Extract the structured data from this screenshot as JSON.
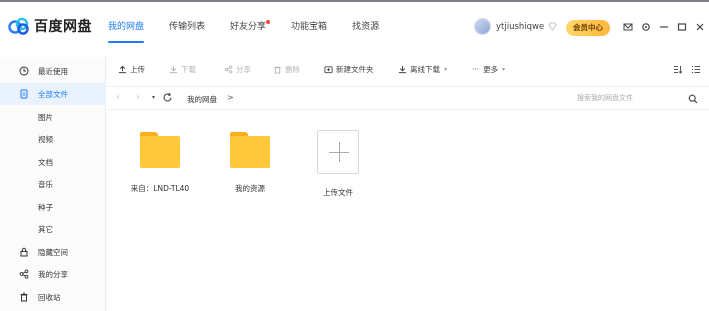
{
  "app": {
    "title": "百度网盘"
  },
  "nav": {
    "tabs": [
      {
        "label": "我的网盘",
        "active": true
      },
      {
        "label": "传输列表"
      },
      {
        "label": "好友分享",
        "dot": true
      },
      {
        "label": "功能宝箱"
      },
      {
        "label": "找资源"
      }
    ]
  },
  "user": {
    "name": "ytjiushiqwe",
    "vip_label": "会员中心"
  },
  "sidebar": {
    "items": [
      {
        "label": "最近使用",
        "icon": "clock-icon"
      },
      {
        "label": "全部文件",
        "icon": "file-icon",
        "active": true
      },
      {
        "label": "图片"
      },
      {
        "label": "视频"
      },
      {
        "label": "文档"
      },
      {
        "label": "音乐"
      },
      {
        "label": "种子"
      },
      {
        "label": "其它"
      },
      {
        "label": "隐藏空间",
        "icon": "lock-icon"
      },
      {
        "label": "我的分享",
        "icon": "share-icon"
      },
      {
        "label": "回收站",
        "icon": "trash-icon"
      }
    ]
  },
  "toolbar": {
    "upload": "上传",
    "download": "下载",
    "share": "分享",
    "delete": "删除",
    "new_folder": "新建文件夹",
    "offline_download": "离线下载",
    "more": "更多"
  },
  "address": {
    "breadcrumb": "我的网盘",
    "separator": ">",
    "search_placeholder": "搜索我的网盘文件"
  },
  "files": [
    {
      "name": "来自：LND-TL40",
      "type": "folder"
    },
    {
      "name": "我的资源",
      "type": "folder"
    },
    {
      "name": "上传文件",
      "type": "upload"
    }
  ],
  "colors": {
    "accent": "#1e7cf5",
    "folder": "#ffc83d",
    "vip": "#ffb63d"
  }
}
